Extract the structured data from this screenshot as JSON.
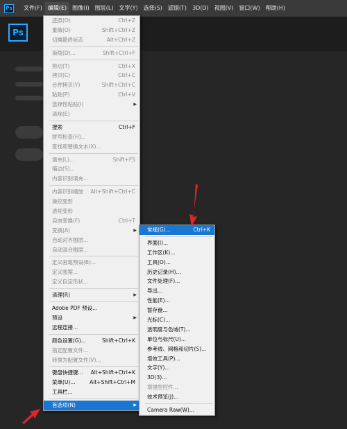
{
  "app_icon": "Ps",
  "logo": "Ps",
  "menubar": [
    "文件(F)",
    "编辑(E)",
    "图像(I)",
    "图层(L)",
    "文字(Y)",
    "选择(S)",
    "滤镜(T)",
    "3D(D)",
    "视图(V)",
    "窗口(W)",
    "帮助(H)"
  ],
  "edit_menu": {
    "items": [
      {
        "label": "还原(O)",
        "shortcut": "Ctrl+Z",
        "disabled": true
      },
      {
        "label": "重做(O)",
        "shortcut": "Shift+Ctrl+Z",
        "disabled": true
      },
      {
        "label": "切换最终状态",
        "shortcut": "Alt+Ctrl+Z",
        "disabled": true
      },
      {
        "sep": true
      },
      {
        "label": "渐隐(D)...",
        "shortcut": "Shift+Ctrl+F",
        "disabled": true
      },
      {
        "sep": true
      },
      {
        "label": "剪切(T)",
        "shortcut": "Ctrl+X",
        "disabled": true
      },
      {
        "label": "拷贝(C)",
        "shortcut": "Ctrl+C",
        "disabled": true
      },
      {
        "label": "合并拷贝(Y)",
        "shortcut": "Shift+Ctrl+C",
        "disabled": true
      },
      {
        "label": "粘贴(P)",
        "shortcut": "Ctrl+V",
        "disabled": true
      },
      {
        "label": "选择性粘贴(I)",
        "shortcut": "",
        "disabled": true,
        "submenu": true
      },
      {
        "label": "清除(E)",
        "shortcut": "",
        "disabled": true
      },
      {
        "sep": true
      },
      {
        "label": "搜索",
        "shortcut": "Ctrl+F",
        "disabled": false
      },
      {
        "label": "拼写检查(H)...",
        "shortcut": "",
        "disabled": true
      },
      {
        "label": "查找和替换文本(X)...",
        "shortcut": "",
        "disabled": true
      },
      {
        "sep": true
      },
      {
        "label": "填充(L)...",
        "shortcut": "Shift+F5",
        "disabled": true
      },
      {
        "label": "描边(S)...",
        "shortcut": "",
        "disabled": true
      },
      {
        "label": "内容识别填充...",
        "shortcut": "",
        "disabled": true
      },
      {
        "sep": true
      },
      {
        "label": "内容识别缩放",
        "shortcut": "Alt+Shift+Ctrl+C",
        "disabled": true
      },
      {
        "label": "操控变形",
        "shortcut": "",
        "disabled": true
      },
      {
        "label": "透视变形",
        "shortcut": "",
        "disabled": true
      },
      {
        "label": "自由变换(F)",
        "shortcut": "Ctrl+T",
        "disabled": true
      },
      {
        "label": "变换(A)",
        "shortcut": "",
        "disabled": true,
        "submenu": true
      },
      {
        "label": "自动对齐图层...",
        "shortcut": "",
        "disabled": true
      },
      {
        "label": "自动混合图层...",
        "shortcut": "",
        "disabled": true
      },
      {
        "sep": true
      },
      {
        "label": "定义画笔预设(B)...",
        "shortcut": "",
        "disabled": true
      },
      {
        "label": "定义图案...",
        "shortcut": "",
        "disabled": true
      },
      {
        "label": "定义自定形状...",
        "shortcut": "",
        "disabled": true
      },
      {
        "sep": true
      },
      {
        "label": "清理(R)",
        "shortcut": "",
        "disabled": false,
        "submenu": true
      },
      {
        "sep": true
      },
      {
        "label": "Adobe PDF 预设...",
        "shortcut": "",
        "disabled": false
      },
      {
        "label": "预设",
        "shortcut": "",
        "disabled": false,
        "submenu": true
      },
      {
        "label": "远程连接...",
        "shortcut": "",
        "disabled": false
      },
      {
        "sep": true
      },
      {
        "label": "颜色设置(G)...",
        "shortcut": "Shift+Ctrl+K",
        "disabled": false
      },
      {
        "label": "指定配置文件...",
        "shortcut": "",
        "disabled": true
      },
      {
        "label": "转换为配置文件(V)...",
        "shortcut": "",
        "disabled": true
      },
      {
        "sep": true
      },
      {
        "label": "键盘快捷键...",
        "shortcut": "Alt+Shift+Ctrl+K",
        "disabled": false
      },
      {
        "label": "菜单(U)...",
        "shortcut": "Alt+Shift+Ctrl+M",
        "disabled": false
      },
      {
        "label": "工具栏...",
        "shortcut": "",
        "disabled": false
      },
      {
        "sep": true
      },
      {
        "label": "首选项(N)",
        "shortcut": "",
        "disabled": false,
        "submenu": true,
        "highlighted": true
      }
    ]
  },
  "preferences_submenu": {
    "items": [
      {
        "label": "常规(G)...",
        "shortcut": "Ctrl+K",
        "highlighted": true
      },
      {
        "sep": true
      },
      {
        "label": "界面(I)..."
      },
      {
        "label": "工作区(K)..."
      },
      {
        "label": "工具(O)..."
      },
      {
        "label": "历史记录(H)..."
      },
      {
        "label": "文件处理(F)..."
      },
      {
        "label": "导出..."
      },
      {
        "label": "性能(E)..."
      },
      {
        "label": "暂存盘..."
      },
      {
        "label": "光标(C)..."
      },
      {
        "label": "透明度与色域(T)..."
      },
      {
        "label": "单位与标尺(U)..."
      },
      {
        "label": "参考线、网格和切片(S)..."
      },
      {
        "label": "增效工具(P)..."
      },
      {
        "label": "文字(Y)..."
      },
      {
        "label": "3D(3)..."
      },
      {
        "label": "增强型控件...",
        "disabled": true
      },
      {
        "label": "技术预览(J)..."
      },
      {
        "sep": true
      },
      {
        "label": "Camera Raw(W)..."
      }
    ]
  },
  "colors": {
    "highlight": "#1976d2",
    "annotation": "#e0262a"
  }
}
